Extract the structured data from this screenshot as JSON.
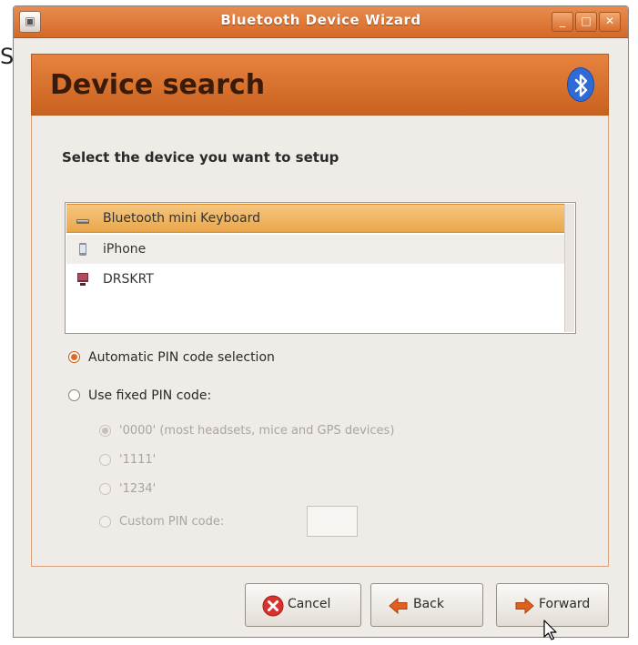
{
  "background": {
    "fragment": "SS"
  },
  "window": {
    "title": "Bluetooth Device Wizard",
    "menu_icon": "window-menu-icon",
    "controls": {
      "minimize": "minimize-icon",
      "maximize": "maximize-icon",
      "close": "close-icon"
    }
  },
  "header": {
    "title": "Device search",
    "icon": "bluetooth-icon"
  },
  "prompt": "Select the device you want to setup",
  "devices": [
    {
      "label": "Bluetooth mini Keyboard",
      "icon": "keyboard-icon",
      "selected": true
    },
    {
      "label": "iPhone",
      "icon": "phone-icon",
      "selected": false
    },
    {
      "label": "DRSKRT",
      "icon": "computer-icon",
      "selected": false
    }
  ],
  "pin_options": {
    "automatic": {
      "label": "Automatic PIN code selection",
      "checked": true
    },
    "fixed": {
      "label": "Use fixed PIN code:",
      "checked": false
    },
    "fixed_choices": [
      {
        "label": "'0000' (most headsets, mice and GPS devices)",
        "checked": true
      },
      {
        "label": "'1111'",
        "checked": false
      },
      {
        "label": "'1234'",
        "checked": false
      },
      {
        "label": "Custom PIN code:",
        "checked": false
      }
    ],
    "custom_value": ""
  },
  "buttons": {
    "cancel": {
      "label": "Cancel",
      "icon": "cancel-icon"
    },
    "back": {
      "label": "Back",
      "icon": "back-arrow-icon"
    },
    "forward": {
      "label": "Forward",
      "icon": "forward-arrow-icon"
    }
  },
  "colors": {
    "accent": "#d56a28",
    "selection": "#eaa64c",
    "bluetooth": "#2f6bd6"
  }
}
